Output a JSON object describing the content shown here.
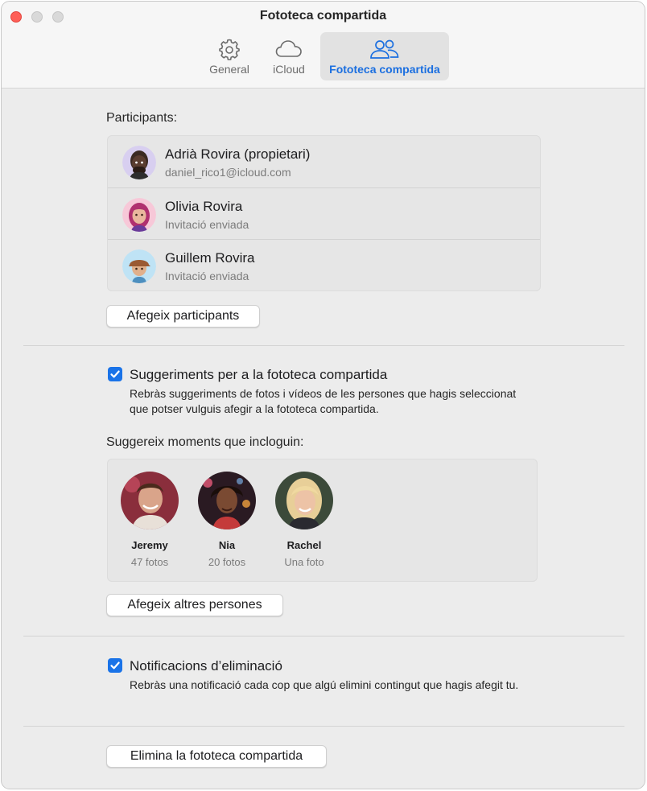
{
  "window": {
    "title": "Fototeca compartida"
  },
  "tabs": [
    {
      "label": "General",
      "icon": "gear-icon"
    },
    {
      "label": "iCloud",
      "icon": "cloud-icon"
    },
    {
      "label": "Fototeca compartida",
      "icon": "people-icon",
      "selected": true
    }
  ],
  "participants": {
    "label": "Participants:",
    "items": [
      {
        "name": "Adrià Rovira (propietari)",
        "detail": "daniel_rico1@icloud.com",
        "avatar": "memoji-man-beard"
      },
      {
        "name": "Olivia Rovira",
        "detail": "Invitació enviada",
        "avatar": "memoji-woman-pink-hair"
      },
      {
        "name": "Guillem Rovira",
        "detail": "Invitació enviada",
        "avatar": "memoji-boy-cap"
      }
    ],
    "add_button": "Afegeix participants"
  },
  "suggestions": {
    "checked": true,
    "label": "Suggeriments per a la fototeca compartida",
    "description": "Rebràs suggeriments de fotos i vídeos de les persones que hagis seleccionat que potser vulguis afegir a la fototeca compartida."
  },
  "moments": {
    "label": "Suggereix moments que incloguin:",
    "people": [
      {
        "name": "Jeremy",
        "count": "47 fotos"
      },
      {
        "name": "Nia",
        "count": "20 fotos"
      },
      {
        "name": "Rachel",
        "count": "Una foto"
      }
    ],
    "add_button": "Afegeix altres persones"
  },
  "deletion": {
    "checked": true,
    "label": "Notificacions d’eliminació",
    "description": "Rebràs una notificació cada cop que algú elimini contingut que hagis afegit tu."
  },
  "delete_button": "Elimina la fototeca compartida",
  "colors": {
    "accent": "#1a73e8",
    "selected_tab_text": "#1b6fe0",
    "close": "#fe5f57"
  }
}
